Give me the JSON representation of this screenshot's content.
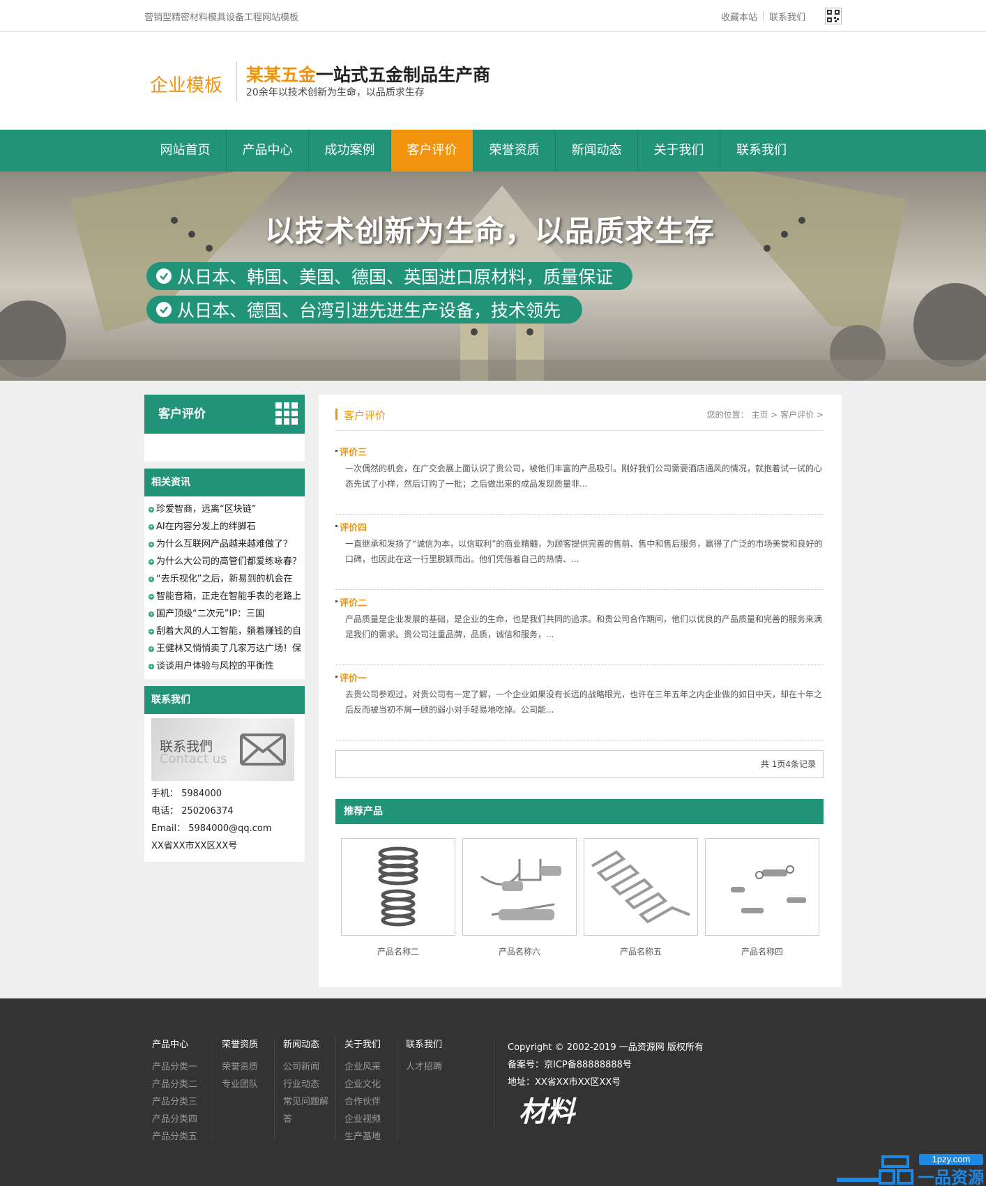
{
  "topbar": {
    "site_desc": "营销型精密材料模具设备工程网站模板",
    "bookmark": "收藏本站",
    "contact": "联系我们"
  },
  "header": {
    "logo": "企业模板",
    "brand": "某某五金",
    "slogan_rest": "一站式五金制品生产商",
    "sub": "20余年以技术创新为生命，以品质求生存"
  },
  "nav": [
    "网站首页",
    "产品中心",
    "成功案例",
    "客户评价",
    "荣誉资质",
    "新闻动态",
    "关于我们",
    "联系我们"
  ],
  "nav_active": 3,
  "banner": {
    "headline": "以技术创新为生命，以品质求生存",
    "point1": "从日本、韩国、美国、德国、英国进口原材料，质量保证",
    "point2": "从日本、德国、台湾引进先进生产设备，技术领先"
  },
  "sidebar": {
    "title": "客户评价",
    "news_title": "相关资讯",
    "news": [
      "珍爱智商，远离“区块链”",
      "AI在内容分发上的绊脚石",
      "为什么互联网产品越来越难做了？",
      "为什么大公司的高管们都爱练咏春？",
      "“去乐视化”之后，新易到的机会在",
      "智能音箱，正走在智能手表的老路上",
      "国产顶级“二次元”IP：三国",
      "刮着大风的人工智能，躺着赚钱的自",
      "王健林又悄悄卖了几家万达广场！保",
      "谈谈用户体验与风控的平衡性"
    ],
    "contact_title": "联系我们",
    "contact_img_cn": "联系我們",
    "contact_img_en": "Contact us",
    "phone": "手机： 5984000",
    "tel": "电话： 250206374",
    "email": "Email： 5984000@qq.com",
    "address": "XX省XX市XX区XX号"
  },
  "content": {
    "title": "客户评价",
    "crumb": "您的位置： 主页 > 客户评价 >",
    "reviews": [
      {
        "title": "评价三",
        "text": "一次偶然的机会，在广交会展上面认识了贵公司，被他们丰富的产品吸引。刚好我们公司需要酒店通风的情况，就抱着试一试的心态先试了小样，然后订购了一批；之后做出来的成品发现质量非..."
      },
      {
        "title": "评价四",
        "text": "一直继承和发扬了“诚信为本，以信取利”的商业精髓，为顾客提供完善的售前、售中和售后服务，赢得了广泛的市场美誉和良好的口碑，也因此在这一行里脱颖而出。他们凭借着自己的热情、..."
      },
      {
        "title": "评价二",
        "text": "产品质量是企业发展的基础，是企业的生命，也是我们共同的追求。和贵公司合作期间，他们以优良的产品质量和完善的服务来满足我们的需求。贵公司注重品牌，品质，诚信和服务，..."
      },
      {
        "title": "评价一",
        "text": "去贵公司参观过，对贵公司有一定了解，一个企业如果没有长远的战略眼光，也许在三年五年之内企业做的如日中天，却在十年之后反而被当初不屑一顾的弱小对手轻易地吃掉。公司能..."
      }
    ],
    "pager": "共 1页4条记录",
    "rec_title": "推荐产品",
    "products": [
      "产品名称二",
      "产品名称六",
      "产品名称五",
      "产品名称四"
    ]
  },
  "footer": {
    "cols": [
      {
        "h": "产品中心",
        "items": [
          "产品分类一",
          "产品分类二",
          "产品分类三",
          "产品分类四",
          "产品分类五"
        ]
      },
      {
        "h": "荣誉资质",
        "items": [
          "荣誉资质",
          "专业团队"
        ]
      },
      {
        "h": "新闻动态",
        "items": [
          "公司新闻",
          "行业动态",
          "常见问题解",
          "答"
        ]
      },
      {
        "h": "关于我们",
        "items": [
          "企业风采",
          "企业文化",
          "合作伙伴",
          "企业视频",
          "生产基地"
        ]
      },
      {
        "h": "联系我们",
        "items": [
          "人才招聘"
        ]
      }
    ],
    "copyright": "Copyright © 2002-2019 一品资源网 版权所有",
    "icp": "备案号：京ICP备88888888号",
    "address": "地址：XX省XX市XX区XX号",
    "signature": "材料",
    "watermark_url": "1pzy.com",
    "watermark_name": "一品资源网"
  },
  "colors": {
    "accent": "#f0940e",
    "brand": "#219378",
    "footer": "#333333"
  }
}
